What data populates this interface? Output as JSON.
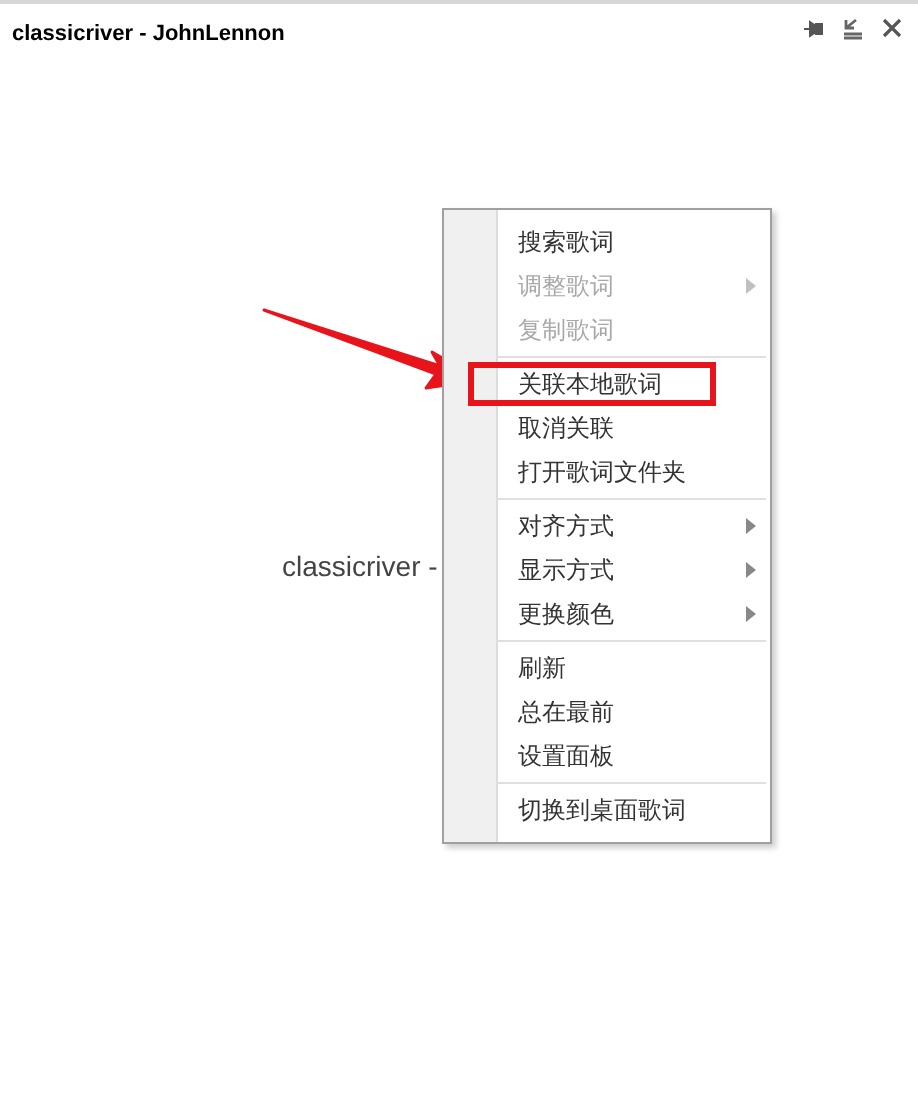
{
  "window": {
    "title": "classicriver - JohnLennon"
  },
  "lyric": "classicriver -",
  "context_menu": [
    {
      "kind": "item",
      "label": "搜索歌词",
      "disabled": false,
      "submenu": false,
      "highlighted": false
    },
    {
      "kind": "item",
      "label": "调整歌词",
      "disabled": true,
      "submenu": true,
      "highlighted": false
    },
    {
      "kind": "item",
      "label": "复制歌词",
      "disabled": true,
      "submenu": false,
      "highlighted": false
    },
    {
      "kind": "separator"
    },
    {
      "kind": "item",
      "label": "关联本地歌词",
      "disabled": false,
      "submenu": false,
      "highlighted": true
    },
    {
      "kind": "item",
      "label": "取消关联",
      "disabled": false,
      "submenu": false,
      "highlighted": false
    },
    {
      "kind": "item",
      "label": "打开歌词文件夹",
      "disabled": false,
      "submenu": false,
      "highlighted": false
    },
    {
      "kind": "separator"
    },
    {
      "kind": "item",
      "label": "对齐方式",
      "disabled": false,
      "submenu": true,
      "highlighted": false
    },
    {
      "kind": "item",
      "label": "显示方式",
      "disabled": false,
      "submenu": true,
      "highlighted": false
    },
    {
      "kind": "item",
      "label": "更换颜色",
      "disabled": false,
      "submenu": true,
      "highlighted": false
    },
    {
      "kind": "separator"
    },
    {
      "kind": "item",
      "label": "刷新",
      "disabled": false,
      "submenu": false,
      "highlighted": false
    },
    {
      "kind": "item",
      "label": "总在最前",
      "disabled": false,
      "submenu": false,
      "highlighted": false
    },
    {
      "kind": "item",
      "label": "设置面板",
      "disabled": false,
      "submenu": false,
      "highlighted": false
    },
    {
      "kind": "separator"
    },
    {
      "kind": "item",
      "label": "切换到桌面歌词",
      "disabled": false,
      "submenu": false,
      "highlighted": false
    }
  ]
}
